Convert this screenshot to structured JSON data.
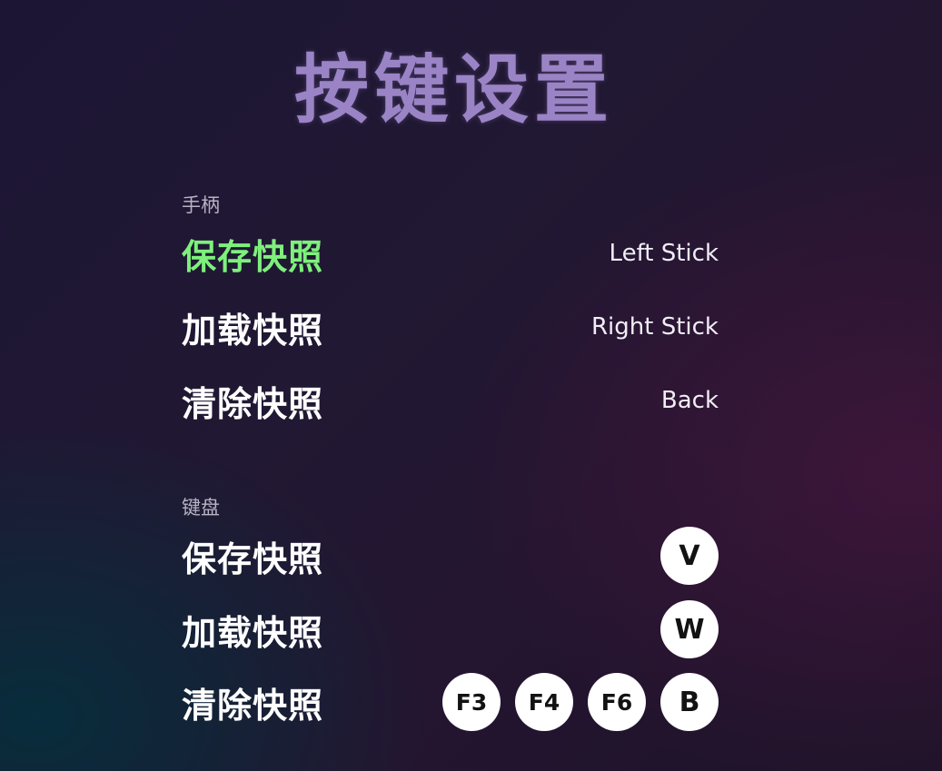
{
  "title": "按键设置",
  "gamepad": {
    "section_label": "手柄",
    "rows": [
      {
        "label": "保存快照",
        "binding": "Left Stick"
      },
      {
        "label": "加载快照",
        "binding": "Right Stick"
      },
      {
        "label": "清除快照",
        "binding": "Back"
      }
    ]
  },
  "keyboard": {
    "section_label": "键盘",
    "rows": [
      {
        "label": "保存快照",
        "keys": [
          "V"
        ]
      },
      {
        "label": "加载快照",
        "keys": [
          "W"
        ]
      },
      {
        "label": "清除快照",
        "keys": [
          "F3",
          "F4",
          "F6",
          "B"
        ]
      }
    ]
  },
  "colors": {
    "title": "#9a84c6",
    "selected_label": "#7ef07c",
    "label": "#ffffff",
    "key_background": "#ffffff"
  }
}
